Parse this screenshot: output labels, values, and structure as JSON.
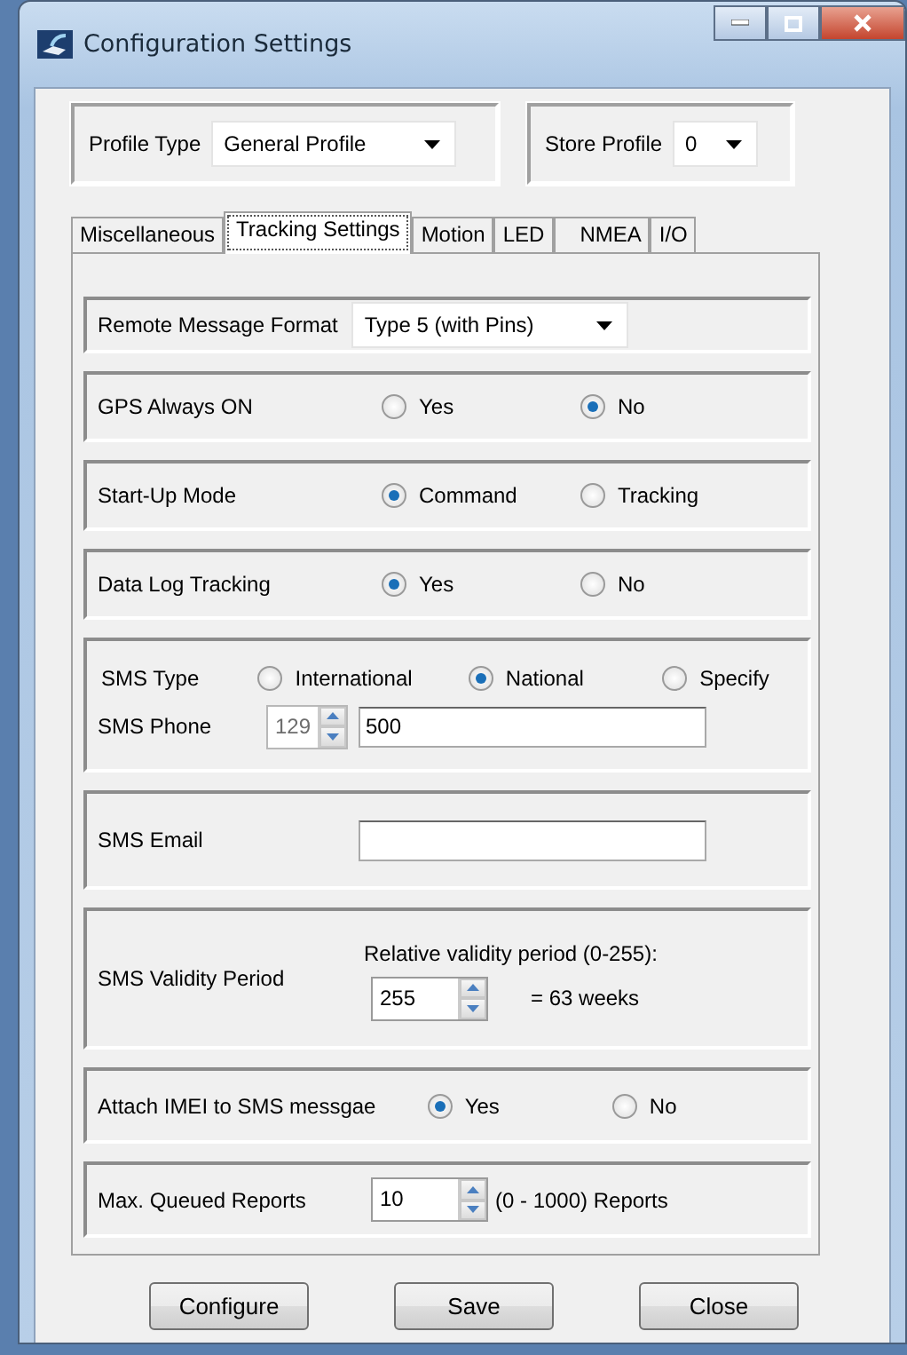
{
  "window": {
    "title": "Configuration Settings"
  },
  "profile_type": {
    "label": "Profile Type",
    "value": "General Profile"
  },
  "store_profile": {
    "label": "Store Profile",
    "value": "0"
  },
  "tabs": [
    {
      "label": "Miscellaneous",
      "selected": false
    },
    {
      "label": "Tracking Settings",
      "selected": true
    },
    {
      "label": "Motion",
      "selected": false
    },
    {
      "label": "LED",
      "selected": false
    },
    {
      "label": "NMEA",
      "selected": false
    },
    {
      "label": "I/O",
      "selected": false
    }
  ],
  "sections": [
    {
      "kind": "dropdown",
      "label": "Remote Message Format",
      "value": "Type 5 (with Pins)"
    },
    {
      "kind": "radio",
      "label": "GPS Always ON",
      "options": [
        {
          "label": "Yes",
          "selected": false
        },
        {
          "label": "No",
          "selected": true
        }
      ]
    },
    {
      "kind": "radio",
      "label": "Start-Up Mode",
      "options": [
        {
          "label": "Command",
          "selected": true
        },
        {
          "label": "Tracking",
          "selected": false
        }
      ]
    },
    {
      "kind": "radio",
      "label": "Data Log Tracking",
      "options": [
        {
          "label": "Yes",
          "selected": true
        },
        {
          "label": "No",
          "selected": false
        }
      ]
    },
    {
      "kind": "sms",
      "label": "SMS Type",
      "options": [
        {
          "label": "International",
          "selected": false
        },
        {
          "label": "National",
          "selected": true
        },
        {
          "label": "Specify",
          "selected": false
        }
      ],
      "phone_label": "SMS Phone",
      "prefix": "129",
      "phone": "500"
    },
    {
      "kind": "text",
      "label": "SMS Email"
    },
    {
      "kind": "validity",
      "label": "SMS Validity Period",
      "caption": "Relative validity period (0-255):",
      "value": "255",
      "note": "= 63 weeks"
    },
    {
      "kind": "radio",
      "label": "Attach IMEI to SMS messgae",
      "options": [
        {
          "label": "Yes",
          "selected": true
        },
        {
          "label": "No",
          "selected": false
        }
      ]
    },
    {
      "kind": "spinner",
      "label": "Max. Queued Reports",
      "value": "10",
      "note": "(0 - 1000) Reports"
    }
  ],
  "buttons": [
    "Configure",
    "Save",
    "Close"
  ]
}
